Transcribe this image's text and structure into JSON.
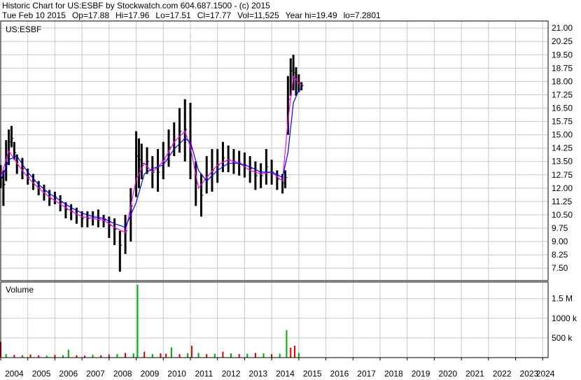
{
  "header": {
    "line1": "Historic Chart for US:ESBF by Stockwatch.com 604.687.1500 - (c) 2015",
    "date": "Tue Feb 10 2015",
    "open": "Op=17.88",
    "high": "Hi=17.96",
    "low": "Lo=17.51",
    "close": "Cl=17.77",
    "volume": "Vol=11,525",
    "year_high": "Year hi=19.49",
    "year_low": "lo=7.2801"
  },
  "colors": {
    "price_bars": "#000000",
    "ma_short": "#ff00ff",
    "ma_long": "#0000ff",
    "volume_up": "#00aa00",
    "volume_down": "#dd0000",
    "grid": "#c8c8c8"
  },
  "chart_data": [
    {
      "type": "line",
      "title": "US:ESBF",
      "symbol": "US:ESBF",
      "ylim": [
        6.8,
        21.4
      ],
      "y_ticks": [
        "21.00",
        "20.25",
        "19.50",
        "18.75",
        "18.00",
        "17.25",
        "16.50",
        "15.75",
        "15.00",
        "14.25",
        "13.50",
        "12.75",
        "12.00",
        "11.25",
        "10.50",
        "9.75",
        "9.00",
        "8.25",
        "7.50"
      ],
      "x_ticks": [
        "2004",
        "2005",
        "2006",
        "2007",
        "2008",
        "2009",
        "2010",
        "2011",
        "2012",
        "2013",
        "2014",
        "2015",
        "2016",
        "2017",
        "2018",
        "2019",
        "2020",
        "2021",
        "2022",
        "2023",
        "2024"
      ],
      "grid": true,
      "series": [
        {
          "style": "price_range",
          "x": [
            2004.0,
            2004.1,
            2004.2,
            2004.3,
            2004.4,
            2004.5,
            2004.6,
            2004.8,
            2005.0,
            2005.2,
            2005.4,
            2005.6,
            2005.8,
            2006.0,
            2006.2,
            2006.4,
            2006.6,
            2006.8,
            2007.0,
            2007.2,
            2007.4,
            2007.6,
            2007.8,
            2008.0,
            2008.2,
            2008.4,
            2008.6,
            2008.8,
            2009.0,
            2009.1,
            2009.2,
            2009.4,
            2009.6,
            2009.8,
            2010.0,
            2010.2,
            2010.4,
            2010.6,
            2010.8,
            2011.0,
            2011.2,
            2011.4,
            2011.6,
            2011.8,
            2012.0,
            2012.2,
            2012.4,
            2012.6,
            2012.8,
            2013.0,
            2013.2,
            2013.4,
            2013.6,
            2013.8,
            2014.0,
            2014.2,
            2014.4,
            2014.5,
            2014.6,
            2014.7,
            2014.8,
            2014.9,
            2015.0,
            2015.1
          ],
          "low": [
            12.0,
            11.0,
            12.4,
            13.3,
            14.3,
            13.6,
            12.8,
            12.5,
            12.2,
            11.9,
            11.6,
            11.3,
            11.0,
            11.1,
            10.7,
            10.3,
            10.2,
            10.0,
            9.8,
            9.8,
            9.9,
            9.8,
            9.8,
            9.2,
            8.8,
            7.3,
            8.3,
            9.0,
            11.5,
            12.0,
            12.5,
            12.8,
            12.0,
            11.8,
            12.5,
            13.2,
            13.8,
            14.0,
            13.5,
            12.5,
            11.0,
            10.4,
            11.7,
            11.8,
            12.3,
            12.9,
            12.9,
            12.8,
            12.7,
            12.6,
            12.3,
            11.9,
            12.0,
            12.2,
            12.2,
            11.9,
            11.7,
            12.0,
            15.0,
            17.2,
            17.5,
            17.2,
            17.4,
            17.5
          ],
          "high": [
            13.3,
            13.0,
            14.7,
            15.3,
            15.5,
            14.6,
            13.9,
            13.7,
            13.1,
            12.8,
            12.4,
            12.2,
            11.9,
            11.8,
            11.6,
            11.2,
            11.1,
            10.9,
            10.7,
            10.7,
            10.7,
            10.8,
            10.5,
            10.4,
            10.3,
            9.6,
            10.5,
            12.0,
            15.2,
            14.8,
            14.5,
            14.3,
            13.8,
            14.2,
            14.6,
            15.3,
            15.7,
            16.5,
            17.0,
            16.8,
            13.5,
            12.8,
            13.8,
            14.2,
            14.2,
            14.6,
            14.4,
            14.2,
            14.1,
            14.0,
            13.8,
            13.5,
            13.4,
            14.2,
            13.6,
            13.0,
            12.8,
            13.0,
            18.3,
            19.3,
            19.5,
            18.8,
            18.4,
            17.96
          ],
          "close": [
            12.6,
            12.2,
            13.7,
            14.6,
            14.8,
            14.0,
            13.3,
            13.1,
            12.6,
            12.4,
            12.0,
            11.8,
            11.4,
            11.5,
            11.2,
            10.8,
            10.7,
            10.5,
            10.3,
            10.3,
            10.3,
            10.3,
            10.2,
            9.9,
            9.7,
            8.8,
            9.6,
            11.0,
            13.8,
            13.6,
            13.4,
            13.5,
            12.9,
            12.9,
            13.6,
            14.3,
            14.7,
            15.2,
            15.3,
            14.2,
            12.3,
            11.6,
            12.7,
            13.0,
            13.3,
            13.7,
            13.6,
            13.5,
            13.4,
            13.3,
            13.1,
            12.7,
            12.7,
            13.2,
            12.9,
            12.5,
            12.3,
            12.6,
            17.0,
            18.6,
            18.5,
            18.0,
            17.9,
            17.77
          ]
        },
        {
          "name": "",
          "style": "ma_short",
          "x": [
            2004.0,
            2004.3,
            2004.6,
            2005.0,
            2005.4,
            2005.8,
            2006.2,
            2006.6,
            2007.0,
            2007.4,
            2007.8,
            2008.2,
            2008.6,
            2009.0,
            2009.3,
            2009.6,
            2010.0,
            2010.4,
            2010.8,
            2011.0,
            2011.3,
            2011.6,
            2012.0,
            2012.4,
            2012.8,
            2013.2,
            2013.6,
            2014.0,
            2014.4,
            2014.6,
            2014.8,
            2015.0,
            2015.1
          ],
          "values": [
            12.6,
            14.1,
            13.4,
            12.6,
            12.0,
            11.5,
            11.1,
            10.7,
            10.4,
            10.3,
            10.2,
            9.8,
            9.5,
            12.5,
            13.4,
            12.9,
            13.5,
            14.6,
            15.2,
            14.3,
            12.0,
            12.6,
            13.3,
            13.6,
            13.4,
            13.0,
            12.8,
            12.9,
            12.4,
            15.8,
            18.3,
            17.9,
            17.8
          ]
        },
        {
          "name": "",
          "style": "ma_long",
          "x": [
            2004.0,
            2004.3,
            2004.6,
            2005.0,
            2005.4,
            2005.8,
            2006.2,
            2006.6,
            2007.0,
            2007.4,
            2007.8,
            2008.2,
            2008.6,
            2009.0,
            2009.3,
            2009.6,
            2010.0,
            2010.4,
            2010.8,
            2011.0,
            2011.3,
            2011.6,
            2012.0,
            2012.4,
            2012.8,
            2013.2,
            2013.6,
            2014.0,
            2014.4,
            2014.6,
            2014.8,
            2015.0,
            2015.1
          ],
          "values": [
            12.4,
            13.6,
            13.8,
            12.9,
            12.2,
            11.7,
            11.3,
            10.9,
            10.6,
            10.4,
            10.3,
            10.0,
            9.8,
            11.2,
            12.8,
            13.1,
            13.3,
            14.2,
            14.8,
            14.6,
            13.0,
            12.4,
            13.0,
            13.4,
            13.4,
            13.2,
            12.9,
            12.9,
            12.6,
            14.0,
            16.8,
            17.5,
            17.6
          ]
        }
      ]
    },
    {
      "type": "bar",
      "title": "Volume",
      "ylim": [
        0,
        1920000
      ],
      "y_ticks": [
        "1.5 M",
        "1000 k",
        "500 k"
      ],
      "y_tick_values": [
        1500000,
        1000000,
        500000
      ],
      "grid": true,
      "series": [
        {
          "x": [
            2004.0,
            2004.2,
            2004.5,
            2004.8,
            2005.1,
            2005.4,
            2005.7,
            2006.0,
            2006.3,
            2006.5,
            2006.8,
            2007.1,
            2007.4,
            2007.7,
            2008.0,
            2008.3,
            2008.6,
            2008.9,
            2009.05,
            2009.3,
            2009.6,
            2009.9,
            2010.1,
            2010.3,
            2010.6,
            2010.9,
            2011.05,
            2011.3,
            2011.6,
            2011.9,
            2012.2,
            2012.5,
            2012.8,
            2013.1,
            2013.4,
            2013.7,
            2014.0,
            2014.3,
            2014.55,
            2014.7,
            2014.85,
            2015.0
          ],
          "values": [
            400000,
            90000,
            70000,
            60000,
            80000,
            60000,
            50000,
            70000,
            60000,
            200000,
            60000,
            50000,
            70000,
            60000,
            80000,
            90000,
            120000,
            110000,
            1850000,
            150000,
            90000,
            110000,
            100000,
            260000,
            90000,
            110000,
            300000,
            120000,
            90000,
            100000,
            150000,
            110000,
            90000,
            100000,
            120000,
            110000,
            90000,
            100000,
            700000,
            250000,
            300000,
            120000
          ],
          "direction": [
            "down",
            "up",
            "down",
            "up",
            "down",
            "down",
            "up",
            "down",
            "up",
            "up",
            "down",
            "down",
            "up",
            "down",
            "down",
            "up",
            "down",
            "up",
            "up",
            "down",
            "up",
            "down",
            "down",
            "up",
            "down",
            "up",
            "down",
            "up",
            "down",
            "up",
            "down",
            "up",
            "down",
            "up",
            "down",
            "up",
            "down",
            "up",
            "up",
            "down",
            "down",
            "up"
          ]
        }
      ]
    }
  ]
}
